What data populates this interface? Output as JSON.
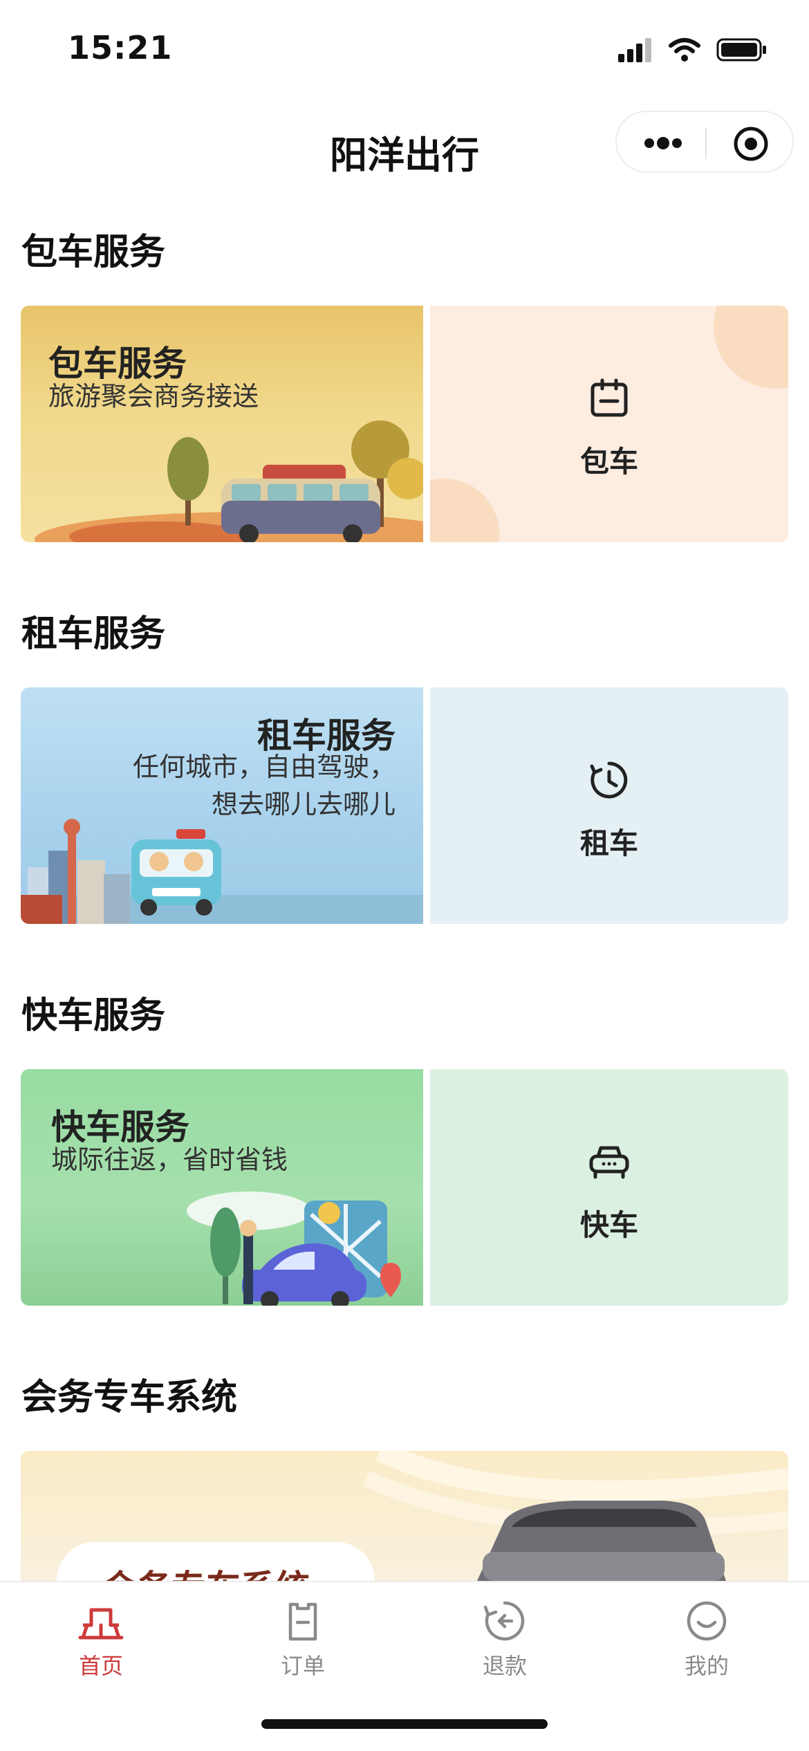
{
  "status_bar": {
    "time": "15:21"
  },
  "nav": {
    "title": "阳洋出行"
  },
  "sections": [
    {
      "title": "包车服务",
      "banner_title": "包车服务",
      "banner_subtitle": [
        "旅游聚会商务接送"
      ],
      "action_label": "包车",
      "action_icon": "calendar-icon"
    },
    {
      "title": "租车服务",
      "banner_title": "租车服务",
      "banner_subtitle": [
        "任何城市，自由驾驶，",
        "想去哪儿去哪儿"
      ],
      "action_label": "租车",
      "action_icon": "clock-icon"
    },
    {
      "title": "快车服务",
      "banner_title": "快车服务",
      "banner_subtitle": [
        "城际往返，省时省钱"
      ],
      "action_label": "快车",
      "action_icon": "car-icon"
    },
    {
      "title": "会务专车系统",
      "banner_title": "会务专车系统"
    }
  ],
  "tabs": [
    {
      "label": "首页",
      "icon": "home-icon",
      "active": true
    },
    {
      "label": "订单",
      "icon": "order-icon",
      "active": false
    },
    {
      "label": "退款",
      "icon": "refund-icon",
      "active": false
    },
    {
      "label": "我的",
      "icon": "profile-icon",
      "active": false
    }
  ],
  "colors": {
    "accent": "#cc3b3b",
    "inactive_tab": "#8a8a8a",
    "charter_panel": "#fdece0",
    "rental_panel": "#e4f0f4",
    "express_panel": "#dcf0e2"
  }
}
